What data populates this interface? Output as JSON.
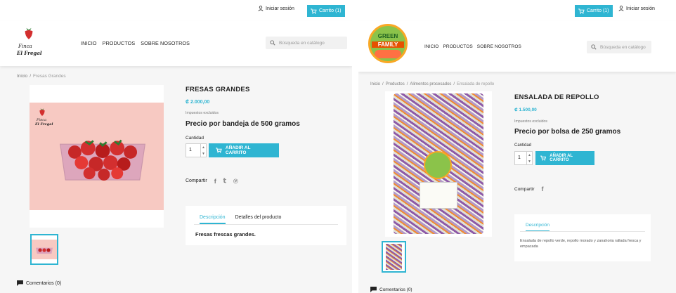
{
  "left": {
    "login": "Iniciar sesión",
    "cart": "Carrito (1)",
    "logo_line1": "Finca",
    "logo_line2": "El Fregal",
    "nav": [
      "INICIO",
      "PRODUCTOS",
      "SOBRE NOSOTROS"
    ],
    "search_placeholder": "Búsqueda en catálogo",
    "breadcrumb": [
      "Inicio",
      "Fresas Grandes"
    ],
    "product_title": "FRESAS GRANDES",
    "price": "₡ 2.000,00",
    "tax": "Impuestos excluidos",
    "subtitle": "Precio por bandeja de 500 gramos",
    "qty_label": "Cantidad",
    "qty_value": "1",
    "add_to_cart": "AÑADIR AL CARRITO",
    "share": "Compartir",
    "social": [
      "f",
      "t",
      "p"
    ],
    "tabs": [
      "Descripción",
      "Detalles del producto"
    ],
    "description": "Fresas frescas grandes.",
    "image_logo_line1": "Finca",
    "image_logo_line2": "El Fregal",
    "comments": "Comentarios (0)"
  },
  "right": {
    "cart": "Carrito (1)",
    "login": "Iniciar sesión",
    "logo_top": "GREEN",
    "logo_bottom": "FAMILY",
    "nav": [
      "INICIO",
      "PRODUCTOS",
      "SOBRE NOSOTROS"
    ],
    "search_placeholder": "Búsqueda en catálogo",
    "breadcrumb": [
      "Inicio",
      "Productos",
      "Alimentos procesados",
      "Ensalada de repollo"
    ],
    "product_title": "ENSALADA DE REPOLLO",
    "price": "₡ 1.500,00",
    "tax": "Impuestos excluidos",
    "subtitle": "Precio por bolsa de 250 gramos",
    "qty_label": "Cantidad",
    "qty_value": "1",
    "add_to_cart": "AÑADIR AL CARRITO",
    "share": "Compartir",
    "social": [
      "f"
    ],
    "tabs": [
      "Descripción"
    ],
    "description": "Ensalada de repollo verde, repollo morado y zanahoria rallada fresca y empacada",
    "comments": "Comentarios (0)"
  },
  "colors": {
    "accent": "#2fb5d2",
    "text": "#232323",
    "background": "#f6f6f6"
  }
}
